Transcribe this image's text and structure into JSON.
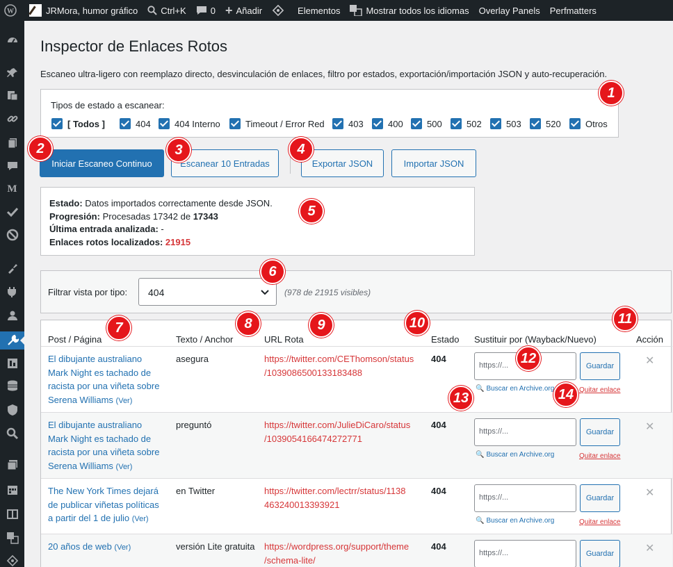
{
  "adminbar": {
    "site": "JRMora, humor gráfico",
    "search": "Ctrl+K",
    "comments": "0",
    "add": "Añadir",
    "elements": "Elementos",
    "languages": "Mostrar todos los idiomas",
    "overlay": "Overlay Panels",
    "perf": "Perfmatters"
  },
  "page": {
    "title": "Inspector de Enlaces Rotos",
    "description": "Escaneo ultra-ligero con reemplazo directo, desvinculación de enlaces, filtro por estados, exportación/importación JSON y auto-recuperación."
  },
  "status_types": {
    "label": "Tipos de estado a escanear:",
    "items": [
      "[ Todos ]",
      "404",
      "404 Interno",
      "Timeout / Error Red",
      "403",
      "400",
      "500",
      "502",
      "503",
      "520",
      "Otros"
    ]
  },
  "buttons": {
    "start": "Iniciar Escaneo Continuo",
    "scan10": "Escanear 10 Entradas",
    "export": "Exportar JSON",
    "import": "Importar JSON"
  },
  "status": {
    "estado_label": "Estado:",
    "estado_value": "Datos importados correctamente desde JSON.",
    "progress_label": "Progresión:",
    "progress_text": "Procesadas 17342 de",
    "progress_total": "17343",
    "last_label": "Última entrada analizada:",
    "last_value": "-",
    "broken_label": "Enlaces rotos localizados:",
    "broken_value": "21915"
  },
  "filter": {
    "label": "Filtrar vista por tipo:",
    "selected": "404",
    "visible": "(978 de 21915 visibles)"
  },
  "table": {
    "headers": {
      "post": "Post / Página",
      "anchor": "Texto / Anchor",
      "url": "URL Rota",
      "estado": "Estado",
      "replace": "Sustituir por (Wayback/Nuevo)",
      "action": "Acción"
    },
    "placeholder": "https://...",
    "save_label": "Guardar",
    "archive_label": "Buscar en Archive.org",
    "remove_label": "Quitar enlace",
    "ver_label": "(Ver)",
    "rows": [
      {
        "post": [
          "El dibujante australiano",
          "Mark Night es tachado de",
          "racista por una viñeta sobre",
          "Serena Williams"
        ],
        "anchor": "asegura",
        "url": [
          "https://twitter.com/CEThomson/status",
          "/1039086500133183488"
        ],
        "status": "404"
      },
      {
        "post": [
          "El dibujante australiano",
          "Mark Night es tachado de",
          "racista por una viñeta sobre",
          "Serena Williams"
        ],
        "anchor": "preguntó",
        "url": [
          "https://twitter.com/JulieDiCaro/status",
          "/1039054166474272771"
        ],
        "status": "404"
      },
      {
        "post": [
          "The New York Times dejará",
          "de publicar viñetas políticas",
          "a partir del 1 de julio"
        ],
        "anchor": "en Twitter",
        "url": [
          "https://twitter.com/lectrr/status/1138",
          "463240013393921"
        ],
        "status": "404"
      },
      {
        "post": [
          "20 años de web"
        ],
        "anchor": "versión Lite gratuita",
        "url": [
          "https://wordpress.org/support/theme",
          "/schema-lite/"
        ],
        "status": "404"
      }
    ]
  },
  "badges": [
    "1",
    "2",
    "3",
    "4",
    "5",
    "6",
    "7",
    "8",
    "9",
    "10",
    "11",
    "12",
    "13",
    "14"
  ],
  "colors": {
    "accent": "#2271b1",
    "danger": "#d63638",
    "badge": "#e5161b",
    "adminbar": "#1d2327"
  }
}
